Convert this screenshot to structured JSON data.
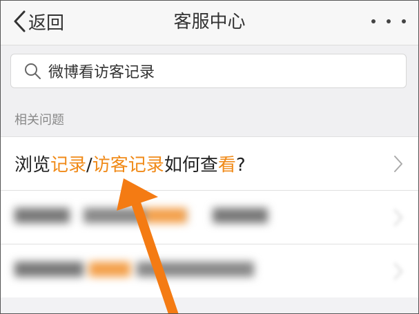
{
  "navbar": {
    "back_label": "返回",
    "title": "客服中心",
    "back_icon": "chevron-left-icon",
    "more_icon": "more-dots-icon"
  },
  "search": {
    "value": "微博看访客记录",
    "icon": "search-icon"
  },
  "section": {
    "label": "相关问题"
  },
  "questions": [
    {
      "segments": [
        {
          "text": "浏览",
          "highlight": false
        },
        {
          "text": "记录",
          "highlight": true
        },
        {
          "text": "/",
          "highlight": false
        },
        {
          "text": "访客记录",
          "highlight": true
        },
        {
          "text": "如何查",
          "highlight": false
        },
        {
          "text": "看",
          "highlight": true
        },
        {
          "text": "?",
          "highlight": false
        }
      ],
      "blurred": false
    },
    {
      "segments": [
        {
          "text": "“",
          "highlight": false
        },
        {
          "text": "",
          "highlight": false
        }
      ],
      "blurred": true
    },
    {
      "segments": [
        {
          "text": "",
          "highlight": false
        }
      ],
      "blurred": true
    }
  ],
  "colors": {
    "highlight": "#f08a18",
    "annotation_arrow": "#f47b13"
  }
}
